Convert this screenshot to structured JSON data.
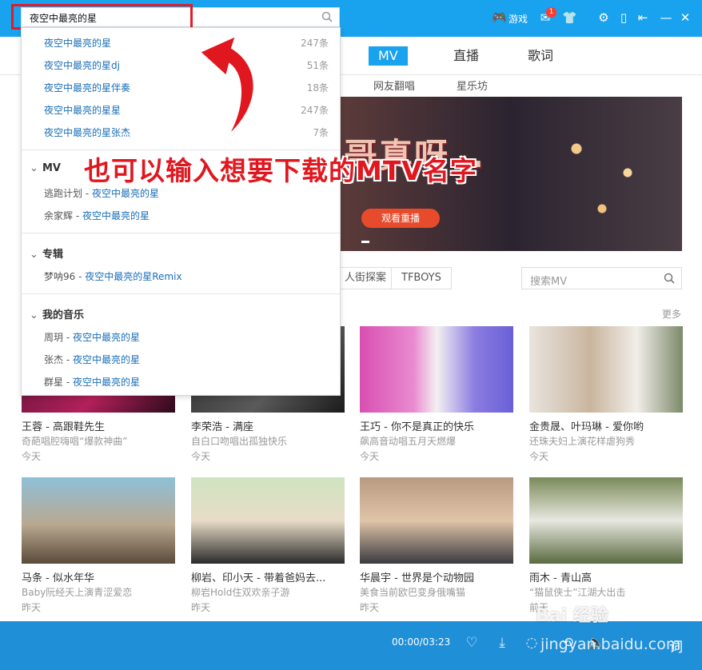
{
  "search": {
    "value": "夜空中最亮的星"
  },
  "topbar": {
    "games_label": "游戏",
    "mail_badge": "1"
  },
  "nav": {
    "tabs": [
      {
        "label": "MV",
        "active": true
      },
      {
        "label": "直播",
        "active": false
      },
      {
        "label": "歌词",
        "active": false
      }
    ],
    "subtabs": [
      "网友翻唱",
      "星乐坊"
    ]
  },
  "banner": {
    "text": "哥真呀…",
    "button": "观看重播"
  },
  "overlay_caption": "也可以输入想要下载的MTV名字",
  "filters": {
    "tags": [
      "人街探案",
      "TFBOYS"
    ],
    "mv_search_placeholder": "搜索MV",
    "more": "更多"
  },
  "suggestions": [
    {
      "prefix": "夜空中最亮的星",
      "suffix": "",
      "count": "247条"
    },
    {
      "prefix": "夜空中最亮的星",
      "suffix": "dj",
      "count": "51条"
    },
    {
      "prefix": "夜空中最亮的星",
      "suffix": "伴奏",
      "count": "18条"
    },
    {
      "prefix": "夜空中最亮的星",
      "suffix": "星",
      "count": "247条"
    },
    {
      "prefix": "夜空中最亮的星",
      "suffix": "张杰",
      "count": "7条"
    }
  ],
  "sections": [
    {
      "title": "MV",
      "items": [
        {
          "artist": "逃跑计划 - ",
          "song": "夜空中最亮的星",
          "tail": ""
        },
        {
          "artist": "余家辉 - ",
          "song": "夜空中最亮的星",
          "tail": ""
        }
      ]
    },
    {
      "title": "专辑",
      "items": [
        {
          "artist": "梦呐96 - ",
          "song": "夜空中最亮的星",
          "tail": "Remix"
        }
      ]
    },
    {
      "title": "我的音乐",
      "items": [
        {
          "artist": "周玥 - ",
          "song": "夜空中最亮的星",
          "tail": ""
        },
        {
          "artist": "张杰 - ",
          "song": "夜空中最亮的星",
          "tail": ""
        },
        {
          "artist": "群星 - ",
          "song": "夜空中最亮的星",
          "tail": ""
        }
      ]
    }
  ],
  "cards": [
    {
      "title": "王蓉 - 高跟鞋先生",
      "desc": "奇葩唱腔嗨唱“爆款神曲”",
      "date": "今天"
    },
    {
      "title": "李荣浩 - 满座",
      "desc": "自白口吻唱出孤独快乐",
      "date": "今天"
    },
    {
      "title": "王巧 - 你不是真正的快乐",
      "desc": "飙高音动唱五月天燃爆",
      "date": "今天"
    },
    {
      "title": "金贵晟、叶玛琳 - 爱你哟",
      "desc": "还珠夫妇上演花样虐狗秀",
      "date": "今天"
    },
    {
      "title": "马条 - 似水年华",
      "desc": "Baby阮经天上演青涩爱恋",
      "date": "昨天"
    },
    {
      "title": "柳岩、印小天 - 带着爸妈去...",
      "desc": "柳岩Hold住双欢亲子游",
      "date": "昨天"
    },
    {
      "title": "华晨宇 - 世界是个动物园",
      "desc": "美食当前欧巴变身俄嘴猫",
      "date": "昨天"
    },
    {
      "title": "雨木 - 青山高",
      "desc": "“猫鼠侠士”江湖大出击",
      "date": "前天"
    }
  ],
  "player": {
    "time": "00:00/03:23",
    "lyric_label": "词"
  },
  "watermark": {
    "line1": "Bai 经验",
    "line2": "jingyan.baidu.com"
  }
}
